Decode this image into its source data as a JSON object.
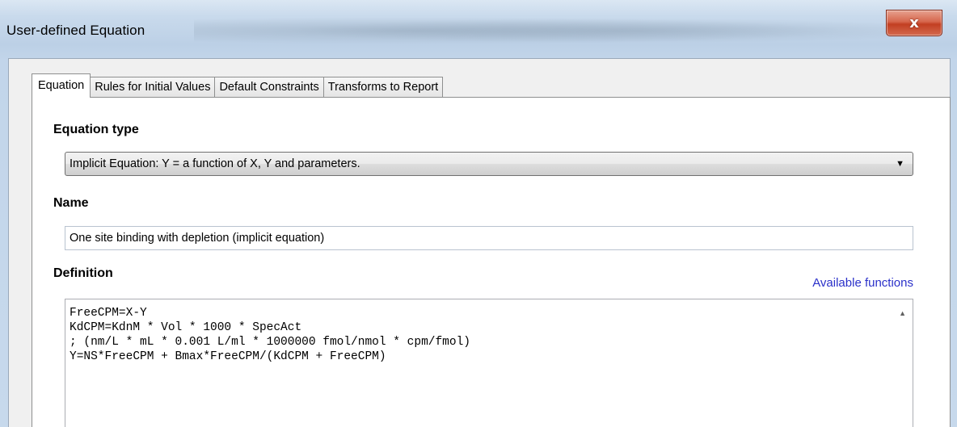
{
  "window": {
    "title": "User-defined Equation",
    "close_glyph": "x"
  },
  "tabs": [
    {
      "label": "Equation",
      "active": true
    },
    {
      "label": "Rules for Initial Values",
      "active": false
    },
    {
      "label": "Default Constraints",
      "active": false
    },
    {
      "label": "Transforms to Report",
      "active": false
    }
  ],
  "equation_type": {
    "label": "Equation type",
    "selected": "Implicit Equation:  Y = a function of X, Y and parameters.",
    "arrow_icon": "chevron-down-icon"
  },
  "name": {
    "label": "Name",
    "value": "One site binding with depletion (implicit equation)"
  },
  "definition": {
    "label": "Definition",
    "link": "Available functions",
    "lines": [
      "FreeCPM=X-Y",
      "KdCPM=KdnM * Vol * 1000 * SpecAct",
      "; (nm/L * mL * 0.001 L/ml * 1000000 fmol/nmol * cpm/fmol)",
      "Y=NS*FreeCPM + Bmax*FreeCPM/(KdCPM + FreeCPM)"
    ]
  },
  "colors": {
    "link": "#2a30c9",
    "close_button": "#c84a2e"
  }
}
